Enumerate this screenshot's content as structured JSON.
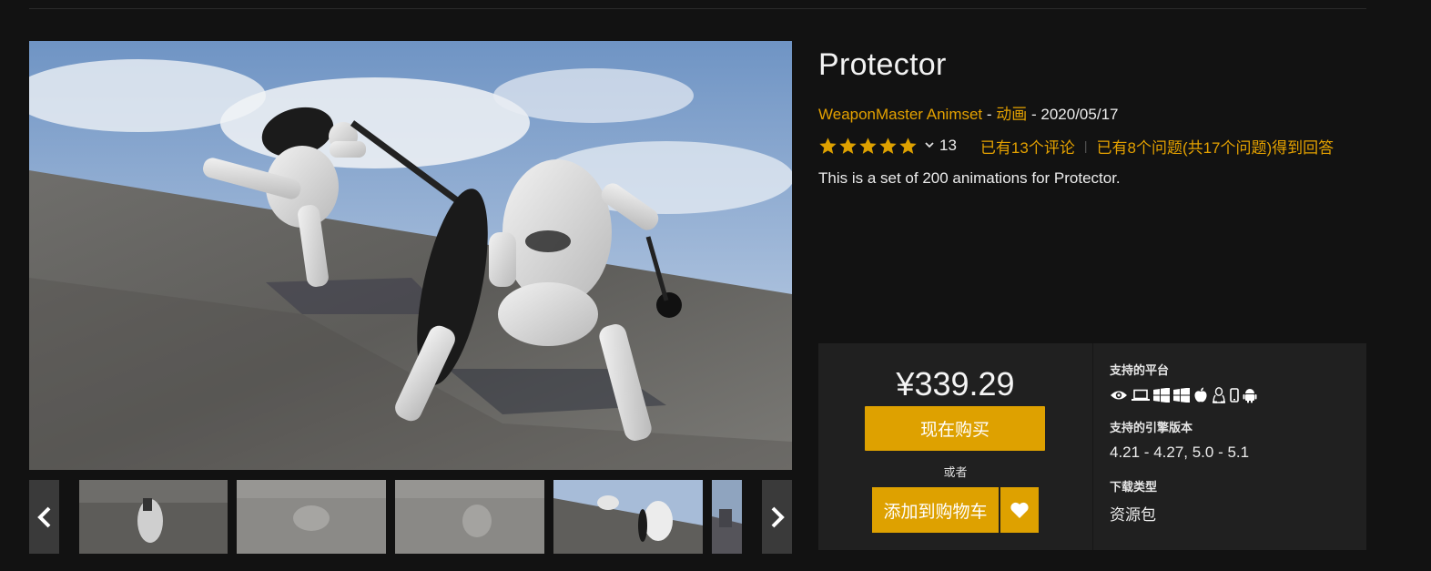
{
  "product": {
    "title": "Protector",
    "seller": "WeaponMaster Animset",
    "meta_sep1": " - ",
    "category": "动画",
    "meta_sep2": " - ",
    "date": "2020/05/17",
    "rating_count": "13",
    "reviews_link": "已有13个评论",
    "questions_link": "已有8个问题(共17个问题)得到回答",
    "description": "This is a set of 200 animations for Protector."
  },
  "purchase": {
    "price": "¥339.29",
    "buy_now": "现在购买",
    "or": "或者",
    "add_to_cart": "添加到购物车"
  },
  "details": {
    "platforms_label": "支持的平台",
    "platform_icons": [
      "eye-icon",
      "laptop-icon",
      "windows-icon",
      "windows-icon",
      "apple-icon",
      "linux-icon",
      "mobile-icon",
      "android-icon"
    ],
    "engine_label": "支持的引擎版本",
    "engine_versions": "4.21 - 4.27, 5.0 - 5.1",
    "download_label": "下载类型",
    "download_type": "资源包"
  },
  "rating": {
    "stars": 5,
    "max": 5
  },
  "colors": {
    "accent": "#dea100",
    "link": "#e4a100",
    "background": "#121212",
    "panel": "#202020"
  }
}
